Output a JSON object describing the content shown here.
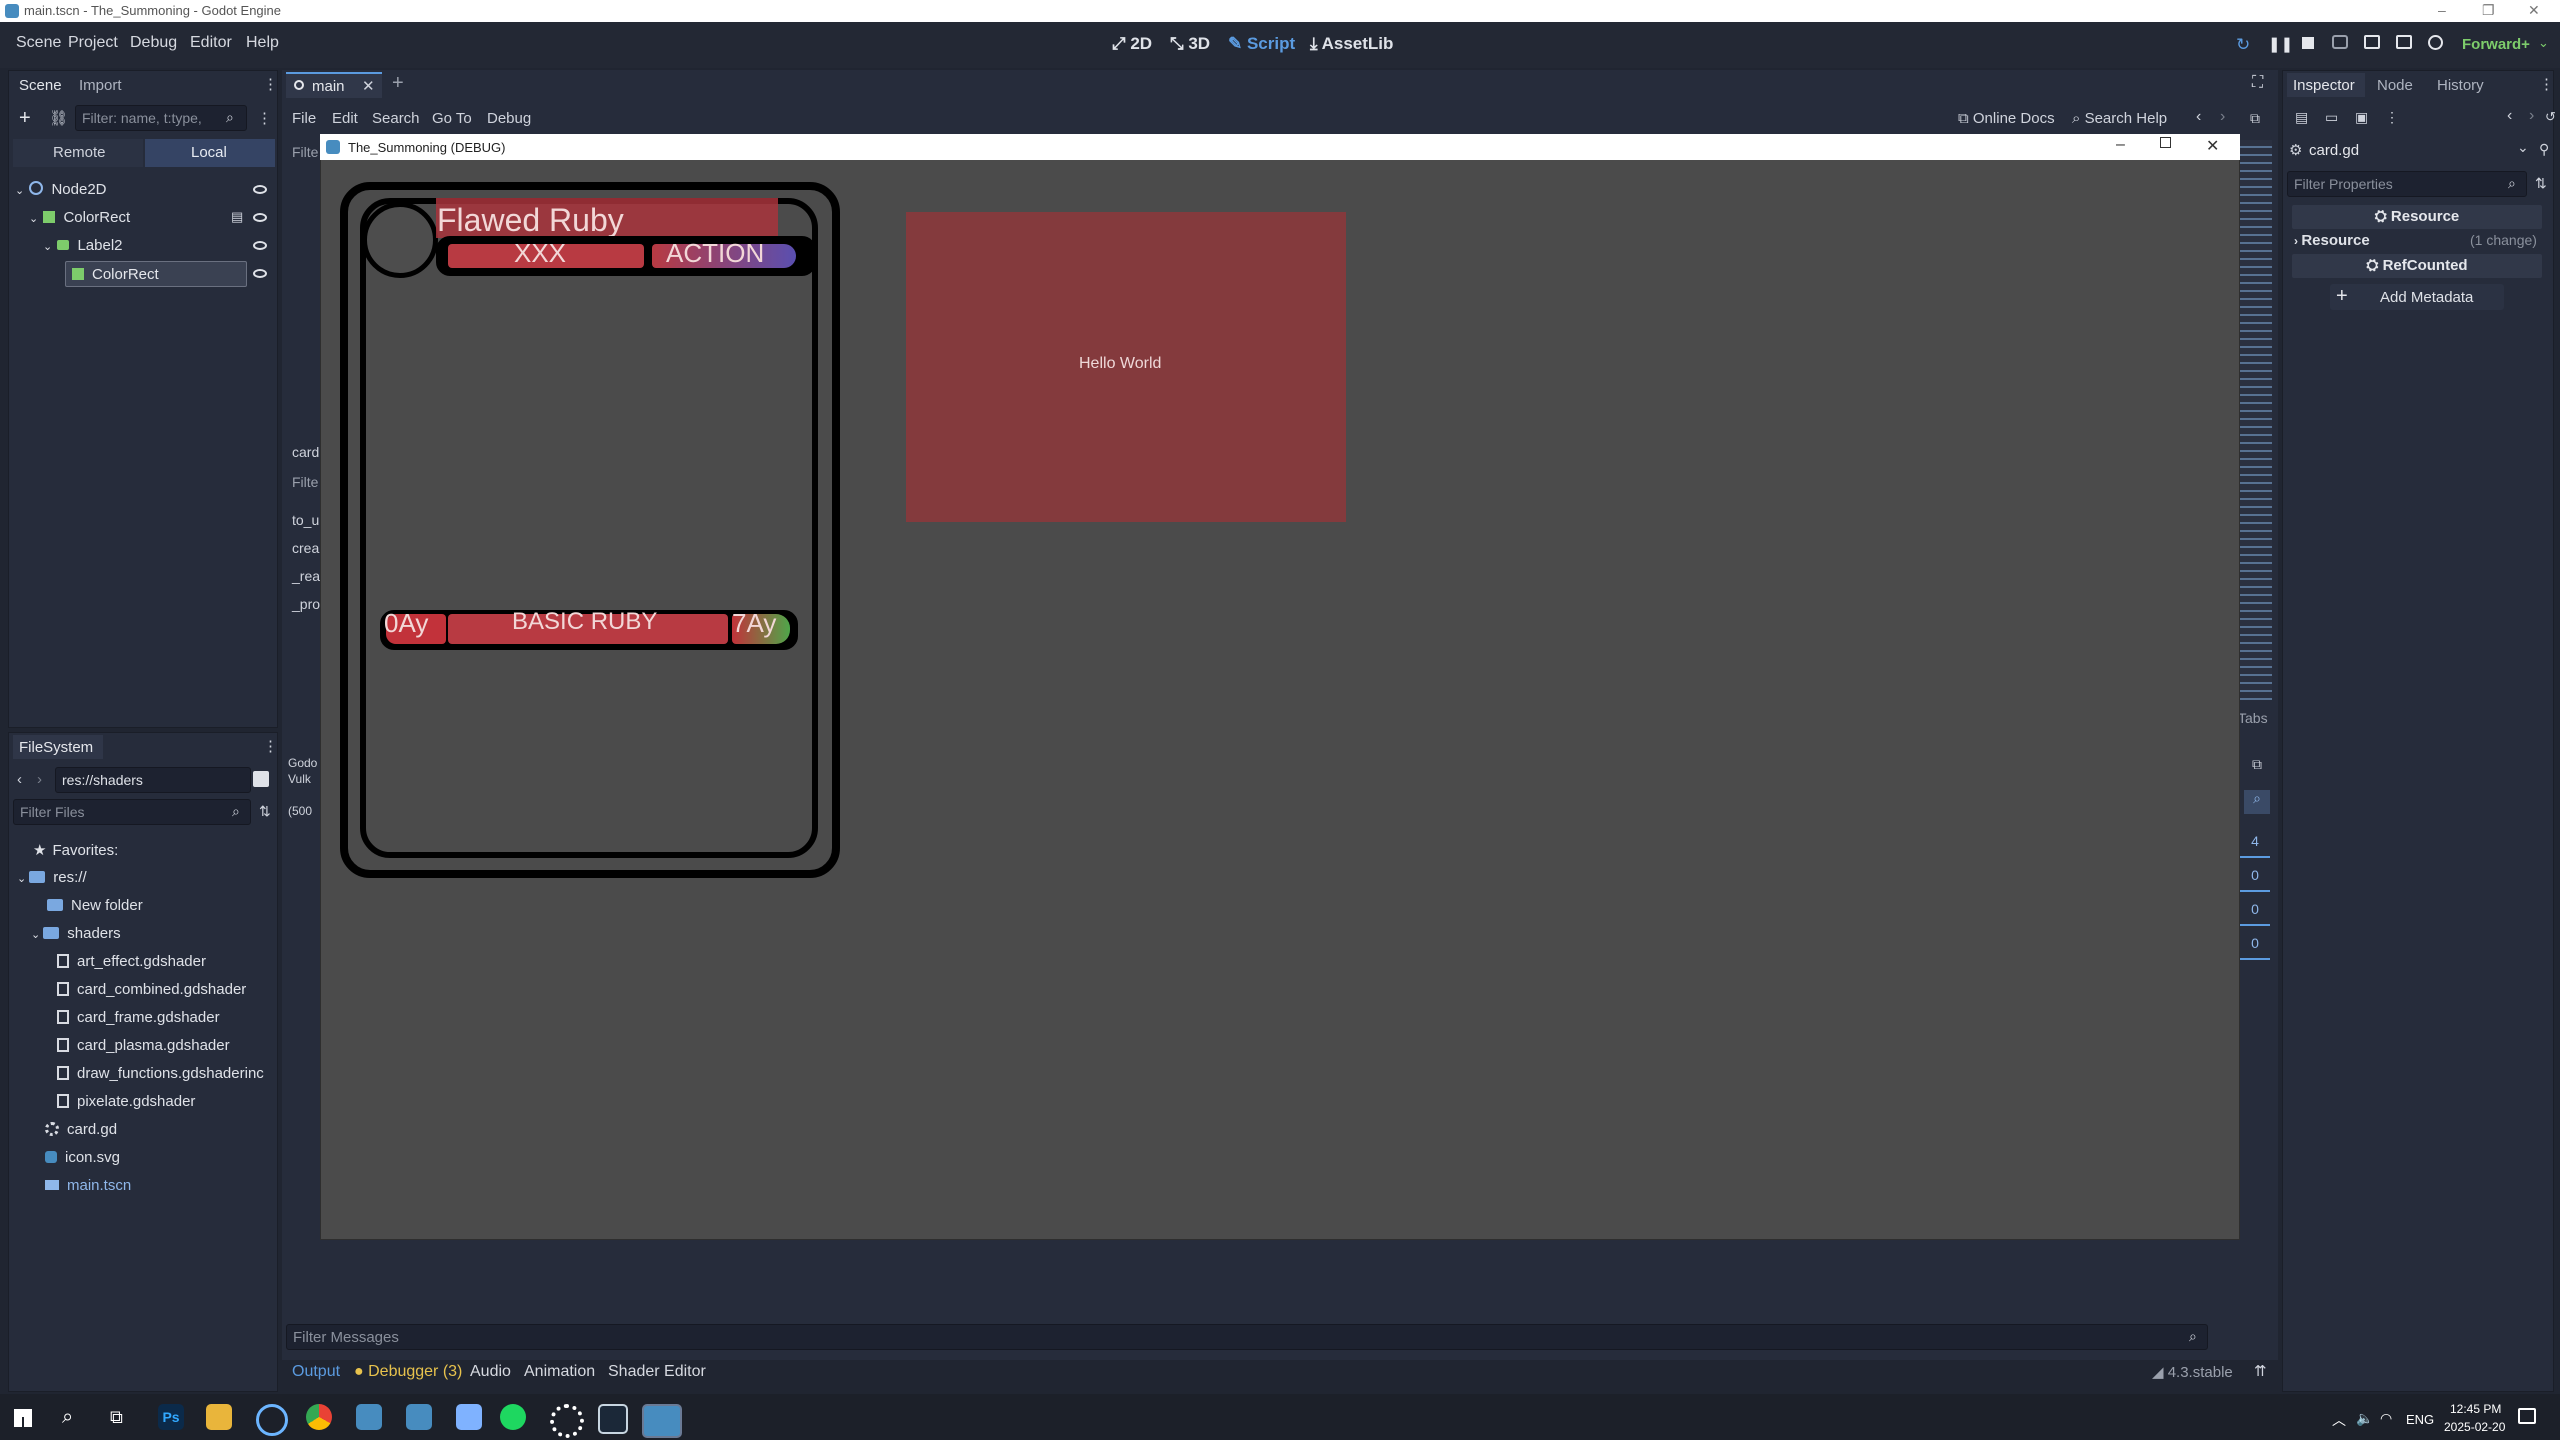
{
  "window": {
    "title": "main.tscn - The_Summoning - Godot Engine",
    "controls": {
      "minimize": "–",
      "restore": "❐",
      "close": "✕"
    }
  },
  "menubar": {
    "items": [
      "Scene",
      "Project",
      "Debug",
      "Editor",
      "Help"
    ],
    "workspaces": {
      "d2": "2D",
      "d3": "3D",
      "script": "Script",
      "assetlib": "AssetLib"
    },
    "renderer": "Forward+"
  },
  "scene_dock": {
    "tabs": [
      "Scene",
      "Import"
    ],
    "filter_placeholder": "Filter: name, t:type,",
    "remote": "Remote",
    "local": "Local",
    "tree": [
      {
        "label": "Node2D"
      },
      {
        "label": "ColorRect"
      },
      {
        "label": "Label2"
      },
      {
        "label": "ColorRect"
      }
    ]
  },
  "filesystem_dock": {
    "title": "FileSystem",
    "path": "res://shaders",
    "filter_placeholder": "Filter Files",
    "favorites": "Favorites:",
    "root": "res://",
    "items": [
      {
        "label": "New folder",
        "kind": "folder"
      },
      {
        "label": "shaders",
        "kind": "folder"
      },
      {
        "label": "art_effect.gdshader",
        "kind": "file"
      },
      {
        "label": "card_combined.gdshader",
        "kind": "file"
      },
      {
        "label": "card_frame.gdshader",
        "kind": "file"
      },
      {
        "label": "card_plasma.gdshader",
        "kind": "file"
      },
      {
        "label": "draw_functions.gdshaderinc",
        "kind": "file"
      },
      {
        "label": "pixelate.gdshader",
        "kind": "file"
      },
      {
        "label": "card.gd",
        "kind": "script"
      },
      {
        "label": "icon.svg",
        "kind": "image"
      },
      {
        "label": "main.tscn",
        "kind": "scene"
      }
    ]
  },
  "script_editor": {
    "tab": "main",
    "menu": [
      "File",
      "Edit",
      "Search",
      "Go To",
      "Debug"
    ],
    "online_docs": "Online Docs",
    "search_help": "Search Help",
    "left_fragments": {
      "filter1": "Filte",
      "card": "card",
      "filter2": "Filte",
      "funcs": [
        "to_u",
        "crea",
        "_rea",
        "_pro"
      ],
      "output": [
        "Godo",
        "Vulk",
        "(500"
      ]
    }
  },
  "game_window": {
    "title": "The_Summoning (DEBUG)",
    "card": {
      "name": "Flawed Ruby",
      "type_left": "XXX",
      "type_right": "ACTION",
      "cost_left": "0Ay",
      "subtype": "BASIC RUBY",
      "cost_right": "7Ay"
    },
    "hello": "Hello World"
  },
  "right_strip": {
    "tabs_label": "Tabs",
    "numbers": [
      "4",
      "0",
      "0",
      "0"
    ]
  },
  "inspector": {
    "tabs": [
      "Inspector",
      "Node",
      "History"
    ],
    "object": "card.gd",
    "filter_placeholder": "Filter Properties",
    "section_resource": "Resource",
    "property_resource": "Resource",
    "property_changes": "(1 change)",
    "section_refcounted": "RefCounted",
    "add_metadata": "Add Metadata"
  },
  "bottom_panel": {
    "filter_placeholder": "Filter Messages",
    "tabs": [
      "Output",
      "Debugger (3)",
      "Audio",
      "Animation",
      "Shader Editor"
    ],
    "version": "4.3.stable"
  },
  "taskbar": {
    "ps_label": "Ps",
    "lang": "ENG",
    "time": "12:45 PM",
    "date": "2025-02-20"
  },
  "colors": {
    "accent": "#5b9be0",
    "card_red": "#c2323a",
    "hello_bg": "#843a3d",
    "debugger_dot": "#e7c24d"
  }
}
